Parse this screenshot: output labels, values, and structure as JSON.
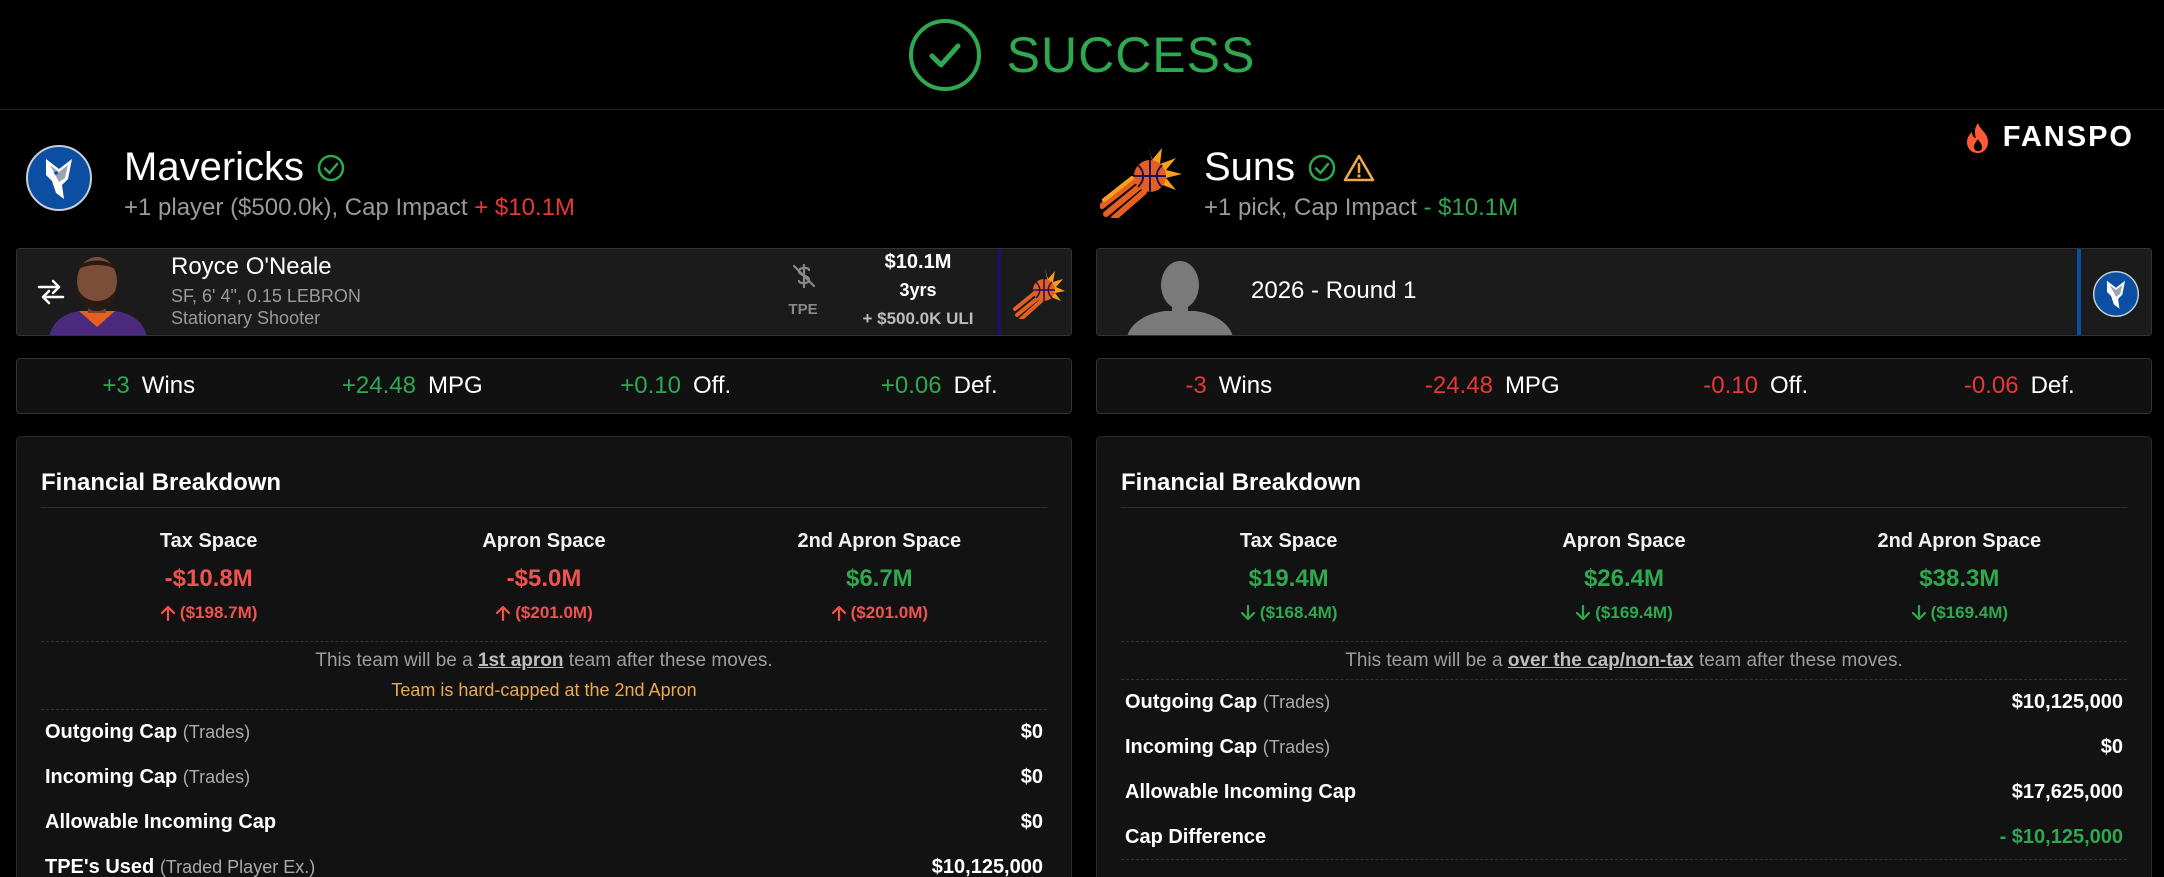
{
  "banner": {
    "status": "SUCCESS"
  },
  "brand": {
    "name": "FANSPO"
  },
  "left": {
    "team": "Mavericks",
    "summary_prefix": "+1 player ($500.0k), Cap Impact",
    "summary_value": "+ $10.1M",
    "player": {
      "name": "Royce O'Neale",
      "details": "SF, 6' 4\", 0.15 LEBRON",
      "role": "Stationary Shooter",
      "tpe_label": "TPE",
      "salary": "$10.1M",
      "years": "3yrs",
      "extra": "+ $500.0K ULI"
    },
    "stats": [
      {
        "value": "+3",
        "label": "Wins"
      },
      {
        "value": "+24.48",
        "label": "MPG"
      },
      {
        "value": "+0.10",
        "label": "Off."
      },
      {
        "value": "+0.06",
        "label": "Def."
      }
    ],
    "financial": {
      "title": "Financial Breakdown",
      "spaces": [
        {
          "label": "Tax Space",
          "value": "-$10.8M",
          "sub": "($198.7M)"
        },
        {
          "label": "Apron Space",
          "value": "-$5.0M",
          "sub": "($201.0M)"
        },
        {
          "label": "2nd Apron Space",
          "value": "$6.7M",
          "sub": "($201.0M)"
        }
      ],
      "note_prefix": "This team will be a",
      "note_link": "1st apron",
      "note_suffix": "team after these moves.",
      "warning": "Team is hard-capped at the 2nd Apron",
      "rows": [
        {
          "label": "Outgoing Cap",
          "qualifier": "(Trades)",
          "value": "$0"
        },
        {
          "label": "Incoming Cap",
          "qualifier": "(Trades)",
          "value": "$0"
        },
        {
          "label": "Allowable Incoming Cap",
          "qualifier": "",
          "value": "$0"
        },
        {
          "label": "TPE's Used",
          "qualifier": "(Traded Player Ex.)",
          "value": "$10,125,000"
        }
      ]
    }
  },
  "right": {
    "team": "Suns",
    "summary_prefix": "+1 pick, Cap Impact",
    "summary_value": "- $10.1M",
    "pick": {
      "label": "2026 - Round 1"
    },
    "stats": [
      {
        "value": "-3",
        "label": "Wins"
      },
      {
        "value": "-24.48",
        "label": "MPG"
      },
      {
        "value": "-0.10",
        "label": "Off."
      },
      {
        "value": "-0.06",
        "label": "Def."
      }
    ],
    "financial": {
      "title": "Financial Breakdown",
      "spaces": [
        {
          "label": "Tax Space",
          "value": "$19.4M",
          "sub": "($168.4M)"
        },
        {
          "label": "Apron Space",
          "value": "$26.4M",
          "sub": "($169.4M)"
        },
        {
          "label": "2nd Apron Space",
          "value": "$38.3M",
          "sub": "($169.4M)"
        }
      ],
      "note_prefix": "This team will be a",
      "note_link": "over the cap/non-tax",
      "note_suffix": "team after these moves.",
      "rows": [
        {
          "label": "Outgoing Cap",
          "qualifier": "(Trades)",
          "value": "$10,125,000"
        },
        {
          "label": "Incoming Cap",
          "qualifier": "(Trades)",
          "value": "$0"
        },
        {
          "label": "Allowable Incoming Cap",
          "qualifier": "",
          "value": "$17,625,000"
        },
        {
          "label": "Cap Difference",
          "qualifier": "",
          "value": "- $10,125,000"
        }
      ]
    }
  },
  "colors": {
    "success": "#2fa84f",
    "negative": "#e53935",
    "positive": "#2fa84f",
    "warning": "#f0a84b",
    "mavs_blue": "#0053bc",
    "suns_orange": "#e56020",
    "suns_purple": "#1d1160"
  }
}
